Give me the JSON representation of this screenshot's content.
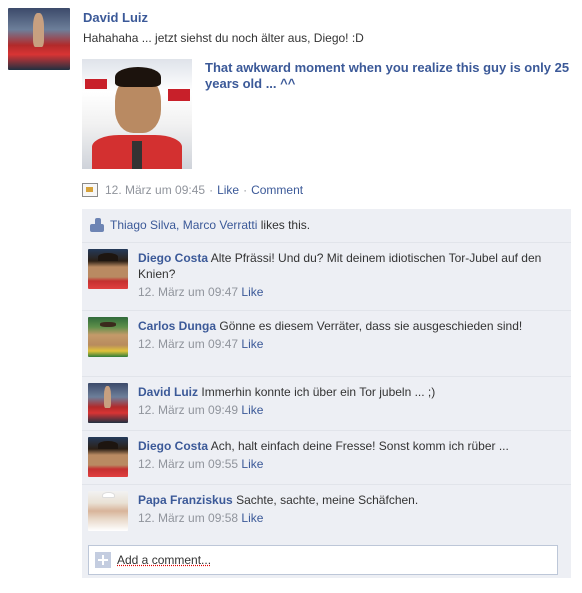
{
  "post": {
    "author": "David Luiz",
    "text": "Hahahaha ... jetzt siehst du noch älter aus, Diego! :D",
    "share_title": "That awkward moment when you realize this guy is only 25 years old ... ^^",
    "timestamp": "12. März um 09:45",
    "sep": "·",
    "like_label": "Like",
    "comment_label": "Comment"
  },
  "likes": {
    "names": "Thiago Silva, Marco Verratti",
    "suffix": " likes this."
  },
  "comments": [
    {
      "author": "Diego Costa",
      "text": "Alte Pfrässi! Und du? Mit deinem idiotischen Tor-Jubel auf den Knien?",
      "time": "12. März um 09:47",
      "like": "Like"
    },
    {
      "author": "Carlos Dunga",
      "text": "Gönne es diesem Verräter, dass sie ausgeschieden sind!",
      "time": "12. März um 09:47",
      "like": "Like"
    },
    {
      "author": "David Luiz",
      "text": "Immerhin konnte ich über ein Tor jubeln ... ;)",
      "time": "12. März um 09:49",
      "like": "Like"
    },
    {
      "author": "Diego Costa",
      "text": "Ach, halt einfach deine Fresse! Sonst komm ich rüber ...",
      "time": "12. März um 09:55",
      "like": "Like"
    },
    {
      "author": "Papa Franziskus",
      "text": "Sachte, sachte, meine Schäfchen.",
      "time": "12. März um 09:58",
      "like": "Like"
    }
  ],
  "add_comment": {
    "placeholder": "Add a comment..."
  },
  "colors": {
    "link": "#3b5998",
    "meta": "#90949c",
    "panel": "#edeff4"
  },
  "icons": {
    "like": "thumbs-up-icon",
    "post_type": "photo-share-icon",
    "add": "add-comment-icon"
  }
}
